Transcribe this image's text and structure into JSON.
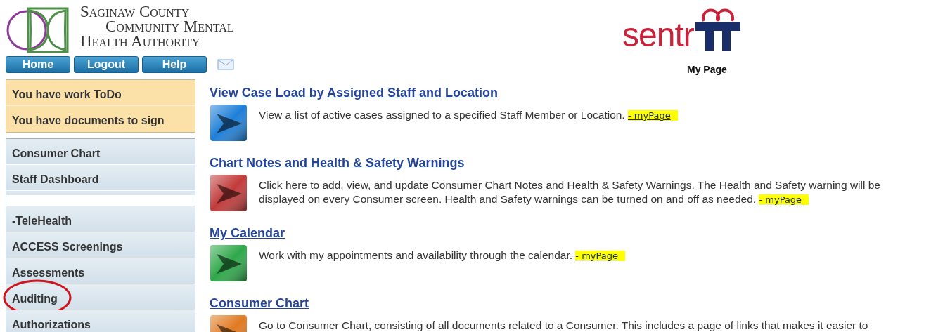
{
  "header": {
    "org_logo": {
      "lines": [
        "Saginaw County",
        "Community Mental",
        "Health Authority"
      ]
    },
    "nav_buttons": [
      "Home",
      "Logout",
      "Help"
    ],
    "product_logo": {
      "text": "sentr"
    },
    "page_title": "My Page"
  },
  "sidebar": {
    "alerts": [
      {
        "label": "You have work ToDo"
      },
      {
        "label": "You have documents to sign"
      }
    ],
    "items": [
      {
        "kind": "link",
        "label": "Consumer Chart",
        "circled": false
      },
      {
        "kind": "link",
        "label": "Staff Dashboard",
        "circled": false
      },
      {
        "kind": "spacer"
      },
      {
        "kind": "link",
        "label": "-TeleHealth",
        "circled": false
      },
      {
        "kind": "link",
        "label": "ACCESS Screenings",
        "circled": false
      },
      {
        "kind": "link",
        "label": "Assessments",
        "circled": false
      },
      {
        "kind": "link",
        "label": "Auditing",
        "circled": true
      },
      {
        "kind": "link",
        "label": "Authorizations",
        "circled": false
      }
    ]
  },
  "entries": [
    {
      "title": "View Case Load by Assigned Staff and Location",
      "color": "#1e7fd8",
      "description": "View a list of active cases assigned to a specified Staff Member or Location.",
      "tag": "- myPage"
    },
    {
      "title": "Chart Notes and Health & Safety Warnings",
      "color": "#c23a3a",
      "description": "Click here to add, view, and update Consumer Chart Notes and Health & Safety Warnings. The Health and Safety warning will be displayed on every Consumer screen. Health and Safety warnings can be turned on and off as needed.",
      "tag": "- myPage"
    },
    {
      "title": "My Calendar",
      "color": "#2ea84a",
      "description": "Work with my appointments and availability through the calendar.",
      "tag": "- myPage"
    },
    {
      "title": "Consumer Chart",
      "color": "#e07a22",
      "description": "Go to Consumer Chart, consisting of all documents related to a Consumer. This includes a page of links that makes it easier to"
    }
  ]
}
